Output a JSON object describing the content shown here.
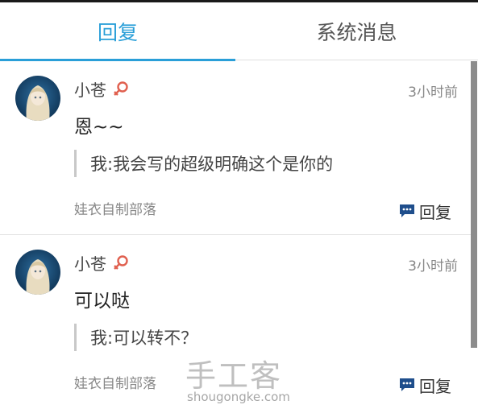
{
  "tabs": [
    {
      "label": "回复",
      "active": true
    },
    {
      "label": "系统消息",
      "active": false
    }
  ],
  "colors": {
    "accent": "#2a9fd8",
    "reply_icon": "#1f4e8c",
    "female_icon": "#e0604f"
  },
  "messages": [
    {
      "username": "小苍",
      "gender_icon": "female-icon",
      "time": "3小时前",
      "content": "恩~~",
      "quote": "我:我会写的超级明确这个是你的",
      "group": "娃衣自制部落",
      "reply_label": "回复"
    },
    {
      "username": "小苍",
      "gender_icon": "female-icon",
      "time": "3小时前",
      "content": "可以哒",
      "quote": "我:可以转不？",
      "group": "娃衣自制部落",
      "reply_label": "回复"
    }
  ],
  "watermark": {
    "logo_text": "手工客",
    "site": "shougongke.com"
  }
}
